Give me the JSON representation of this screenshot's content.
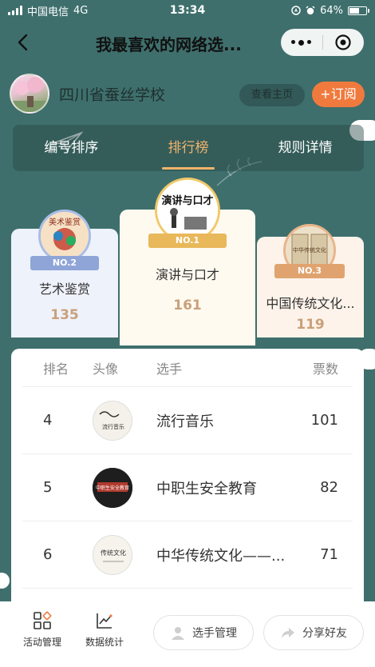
{
  "status_bar": {
    "carrier": "中国电信",
    "network": "4G",
    "time": "13:34",
    "battery": "64%",
    "battery_level": 0.64
  },
  "nav": {
    "title": "我最喜欢的网络选..."
  },
  "school": {
    "name": "四川省蚕丝学校",
    "homepage_label": "查看主页",
    "subscribe_label": "+订阅"
  },
  "tabs": [
    {
      "label": "编号排序",
      "active": false
    },
    {
      "label": "排行榜",
      "active": true
    },
    {
      "label": "规则详情",
      "active": false
    }
  ],
  "podium": {
    "first": {
      "badge": "NO.1",
      "avatar_text": "演讲与口才",
      "name": "演讲与口才",
      "votes": "161"
    },
    "second": {
      "badge": "NO.2",
      "avatar_text": "美术鉴赏",
      "name": "艺术鉴赏",
      "votes": "135"
    },
    "third": {
      "badge": "NO.3",
      "avatar_text": "中华传统文化",
      "name": "中国传统文化...",
      "votes": "119"
    }
  },
  "table": {
    "headers": {
      "rank": "排名",
      "avatar": "头像",
      "player": "选手",
      "votes": "票数"
    },
    "rows": [
      {
        "rank": "4",
        "name": "流行音乐",
        "votes": "101",
        "thumb_text": "流行音乐"
      },
      {
        "rank": "5",
        "name": "中职生安全教育",
        "votes": "82",
        "thumb_text": "中职生安全教育"
      },
      {
        "rank": "6",
        "name": "中华传统文化——...",
        "votes": "71",
        "thumb_text": "传统文化"
      }
    ]
  },
  "bottom_bar": {
    "activity_label": "活动管理",
    "stats_label": "数据统计",
    "player_mgmt_label": "选手管理",
    "share_label": "分享好友"
  },
  "colors": {
    "background": "#3e6f6c",
    "accent_orange": "#f07a3e",
    "tab_active": "#f5b36a",
    "gold": "#e8b85a",
    "silver": "#8fa5d8",
    "bronze": "#e0a36f"
  }
}
